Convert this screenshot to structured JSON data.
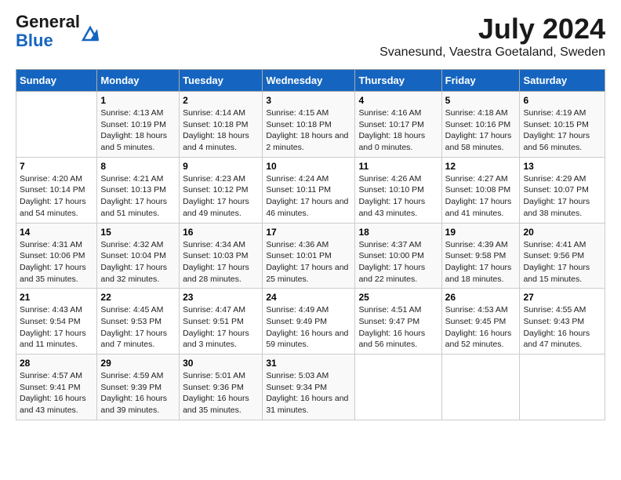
{
  "header": {
    "logo_general": "General",
    "logo_blue": "Blue",
    "title": "July 2024",
    "subtitle": "Svanesund, Vaestra Goetaland, Sweden"
  },
  "calendar": {
    "days_of_week": [
      "Sunday",
      "Monday",
      "Tuesday",
      "Wednesday",
      "Thursday",
      "Friday",
      "Saturday"
    ],
    "weeks": [
      [
        {
          "day": "",
          "sunrise": "",
          "sunset": "",
          "daylight": ""
        },
        {
          "day": "1",
          "sunrise": "Sunrise: 4:13 AM",
          "sunset": "Sunset: 10:19 PM",
          "daylight": "Daylight: 18 hours and 5 minutes."
        },
        {
          "day": "2",
          "sunrise": "Sunrise: 4:14 AM",
          "sunset": "Sunset: 10:18 PM",
          "daylight": "Daylight: 18 hours and 4 minutes."
        },
        {
          "day": "3",
          "sunrise": "Sunrise: 4:15 AM",
          "sunset": "Sunset: 10:18 PM",
          "daylight": "Daylight: 18 hours and 2 minutes."
        },
        {
          "day": "4",
          "sunrise": "Sunrise: 4:16 AM",
          "sunset": "Sunset: 10:17 PM",
          "daylight": "Daylight: 18 hours and 0 minutes."
        },
        {
          "day": "5",
          "sunrise": "Sunrise: 4:18 AM",
          "sunset": "Sunset: 10:16 PM",
          "daylight": "Daylight: 17 hours and 58 minutes."
        },
        {
          "day": "6",
          "sunrise": "Sunrise: 4:19 AM",
          "sunset": "Sunset: 10:15 PM",
          "daylight": "Daylight: 17 hours and 56 minutes."
        }
      ],
      [
        {
          "day": "7",
          "sunrise": "Sunrise: 4:20 AM",
          "sunset": "Sunset: 10:14 PM",
          "daylight": "Daylight: 17 hours and 54 minutes."
        },
        {
          "day": "8",
          "sunrise": "Sunrise: 4:21 AM",
          "sunset": "Sunset: 10:13 PM",
          "daylight": "Daylight: 17 hours and 51 minutes."
        },
        {
          "day": "9",
          "sunrise": "Sunrise: 4:23 AM",
          "sunset": "Sunset: 10:12 PM",
          "daylight": "Daylight: 17 hours and 49 minutes."
        },
        {
          "day": "10",
          "sunrise": "Sunrise: 4:24 AM",
          "sunset": "Sunset: 10:11 PM",
          "daylight": "Daylight: 17 hours and 46 minutes."
        },
        {
          "day": "11",
          "sunrise": "Sunrise: 4:26 AM",
          "sunset": "Sunset: 10:10 PM",
          "daylight": "Daylight: 17 hours and 43 minutes."
        },
        {
          "day": "12",
          "sunrise": "Sunrise: 4:27 AM",
          "sunset": "Sunset: 10:08 PM",
          "daylight": "Daylight: 17 hours and 41 minutes."
        },
        {
          "day": "13",
          "sunrise": "Sunrise: 4:29 AM",
          "sunset": "Sunset: 10:07 PM",
          "daylight": "Daylight: 17 hours and 38 minutes."
        }
      ],
      [
        {
          "day": "14",
          "sunrise": "Sunrise: 4:31 AM",
          "sunset": "Sunset: 10:06 PM",
          "daylight": "Daylight: 17 hours and 35 minutes."
        },
        {
          "day": "15",
          "sunrise": "Sunrise: 4:32 AM",
          "sunset": "Sunset: 10:04 PM",
          "daylight": "Daylight: 17 hours and 32 minutes."
        },
        {
          "day": "16",
          "sunrise": "Sunrise: 4:34 AM",
          "sunset": "Sunset: 10:03 PM",
          "daylight": "Daylight: 17 hours and 28 minutes."
        },
        {
          "day": "17",
          "sunrise": "Sunrise: 4:36 AM",
          "sunset": "Sunset: 10:01 PM",
          "daylight": "Daylight: 17 hours and 25 minutes."
        },
        {
          "day": "18",
          "sunrise": "Sunrise: 4:37 AM",
          "sunset": "Sunset: 10:00 PM",
          "daylight": "Daylight: 17 hours and 22 minutes."
        },
        {
          "day": "19",
          "sunrise": "Sunrise: 4:39 AM",
          "sunset": "Sunset: 9:58 PM",
          "daylight": "Daylight: 17 hours and 18 minutes."
        },
        {
          "day": "20",
          "sunrise": "Sunrise: 4:41 AM",
          "sunset": "Sunset: 9:56 PM",
          "daylight": "Daylight: 17 hours and 15 minutes."
        }
      ],
      [
        {
          "day": "21",
          "sunrise": "Sunrise: 4:43 AM",
          "sunset": "Sunset: 9:54 PM",
          "daylight": "Daylight: 17 hours and 11 minutes."
        },
        {
          "day": "22",
          "sunrise": "Sunrise: 4:45 AM",
          "sunset": "Sunset: 9:53 PM",
          "daylight": "Daylight: 17 hours and 7 minutes."
        },
        {
          "day": "23",
          "sunrise": "Sunrise: 4:47 AM",
          "sunset": "Sunset: 9:51 PM",
          "daylight": "Daylight: 17 hours and 3 minutes."
        },
        {
          "day": "24",
          "sunrise": "Sunrise: 4:49 AM",
          "sunset": "Sunset: 9:49 PM",
          "daylight": "Daylight: 16 hours and 59 minutes."
        },
        {
          "day": "25",
          "sunrise": "Sunrise: 4:51 AM",
          "sunset": "Sunset: 9:47 PM",
          "daylight": "Daylight: 16 hours and 56 minutes."
        },
        {
          "day": "26",
          "sunrise": "Sunrise: 4:53 AM",
          "sunset": "Sunset: 9:45 PM",
          "daylight": "Daylight: 16 hours and 52 minutes."
        },
        {
          "day": "27",
          "sunrise": "Sunrise: 4:55 AM",
          "sunset": "Sunset: 9:43 PM",
          "daylight": "Daylight: 16 hours and 47 minutes."
        }
      ],
      [
        {
          "day": "28",
          "sunrise": "Sunrise: 4:57 AM",
          "sunset": "Sunset: 9:41 PM",
          "daylight": "Daylight: 16 hours and 43 minutes."
        },
        {
          "day": "29",
          "sunrise": "Sunrise: 4:59 AM",
          "sunset": "Sunset: 9:39 PM",
          "daylight": "Daylight: 16 hours and 39 minutes."
        },
        {
          "day": "30",
          "sunrise": "Sunrise: 5:01 AM",
          "sunset": "Sunset: 9:36 PM",
          "daylight": "Daylight: 16 hours and 35 minutes."
        },
        {
          "day": "31",
          "sunrise": "Sunrise: 5:03 AM",
          "sunset": "Sunset: 9:34 PM",
          "daylight": "Daylight: 16 hours and 31 minutes."
        },
        {
          "day": "",
          "sunrise": "",
          "sunset": "",
          "daylight": ""
        },
        {
          "day": "",
          "sunrise": "",
          "sunset": "",
          "daylight": ""
        },
        {
          "day": "",
          "sunrise": "",
          "sunset": "",
          "daylight": ""
        }
      ]
    ]
  }
}
